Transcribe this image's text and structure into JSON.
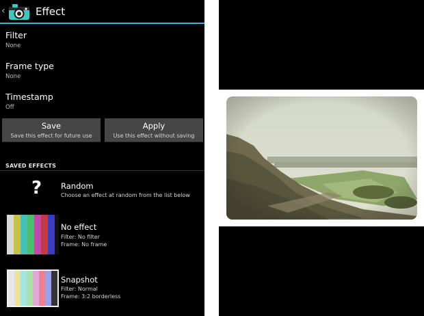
{
  "actionbar": {
    "back_glyph": "‹",
    "title": "Effect",
    "icon": "camera-icon",
    "accent": "#33b5e5"
  },
  "prefs": [
    {
      "title": "Filter",
      "summary": "None"
    },
    {
      "title": "Frame type",
      "summary": "None"
    },
    {
      "title": "Timestamp",
      "summary": "Off"
    }
  ],
  "buttons": {
    "save": {
      "label": "Save",
      "sub": "Save this effect for future use"
    },
    "apply": {
      "label": "Apply",
      "sub": "Use this effect without saving"
    }
  },
  "saved_effects": {
    "header": "SAVED EFFECTS",
    "items": [
      {
        "name": "Random",
        "line1": "Choose an effect at random from the list below",
        "line2": "",
        "thumb": "question-mark-icon"
      },
      {
        "name": "No effect",
        "line1": "Filter: No filter",
        "line2": "Frame: No frame",
        "thumb": "color-bars-vivid"
      },
      {
        "name": "Snapshot",
        "line1": "Filter: Normal",
        "line2": "Frame: 3:2 borderless",
        "thumb": "color-bars-pastel"
      }
    ]
  },
  "preview": {
    "image": "landscape-photo-vintage-frame"
  }
}
